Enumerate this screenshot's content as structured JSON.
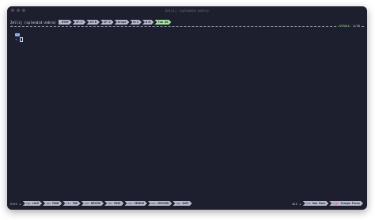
{
  "window": {
    "title": "Zellij (splendid-zebra)"
  },
  "topbar": {
    "session": "Zellij (splendid-zebra)",
    "tabs": [
      "BTOP",
      "SP:T",
      "SP:B",
      "SP:S",
      "Brope",
      "B:S",
      "B:B",
      "Tab #8"
    ],
    "active_tab_index": 7
  },
  "pane": {
    "scroll_label": "SCROLL:",
    "scroll_value": "0/38",
    "prompt_badge": "~",
    "prompt_symbol": "↑"
  },
  "statusbar": {
    "mode": "Ctrl +",
    "keys": [
      {
        "key": "<g>",
        "label": "LOCK"
      },
      {
        "key": "<p>",
        "label": "PANE"
      },
      {
        "key": "<t>",
        "label": "TAB"
      },
      {
        "key": "<n>",
        "label": "RESIZE"
      },
      {
        "key": "<h>",
        "label": "MOVE"
      },
      {
        "key": "<s>",
        "label": "SEARCH"
      },
      {
        "key": "<o>",
        "label": "SESSION"
      },
      {
        "key": "<q>",
        "label": "QUIT"
      }
    ],
    "alt": "Alt +",
    "alt_keys": [
      {
        "key": "<n>",
        "label": "New Pane"
      },
      {
        "key": "<[]>",
        "label": "Change Focus"
      }
    ]
  },
  "colors": {
    "background": "#1e1f2e",
    "tab_inactive": "#b7b9cc",
    "tab_active": "#a6e3a1",
    "accent_blue": "#89b4fa",
    "accent_pink": "#d43f8d"
  }
}
